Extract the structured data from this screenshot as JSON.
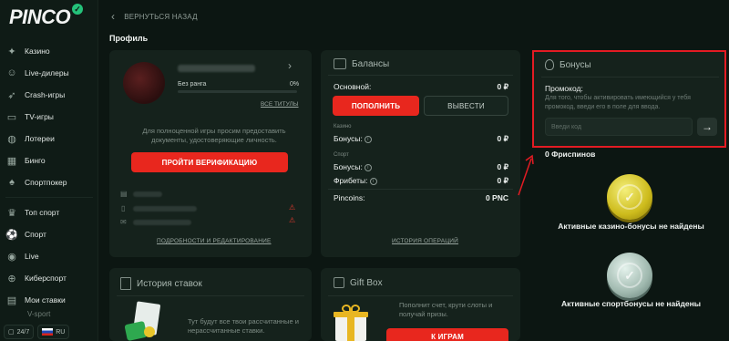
{
  "brand": {
    "logo": "PINCO",
    "logo_mark": "✓"
  },
  "sidebar": {
    "items": [
      {
        "label": "Казино",
        "icon": "casino-icon"
      },
      {
        "label": "Live-дилеры",
        "icon": "dealer-icon"
      },
      {
        "label": "Crash-игры",
        "icon": "rocket-icon"
      },
      {
        "label": "TV-игры",
        "icon": "tv-icon"
      },
      {
        "label": "Лотереи",
        "icon": "lottery-icon"
      },
      {
        "label": "Бинго",
        "icon": "bingo-icon"
      },
      {
        "label": "Спортпокер",
        "icon": "cards-icon"
      },
      {
        "label": "Топ спорт",
        "icon": "top-sport-icon"
      },
      {
        "label": "Спорт",
        "icon": "ball-icon"
      },
      {
        "label": "Live",
        "icon": "live-icon"
      },
      {
        "label": "Киберспорт",
        "icon": "gamepad-icon"
      },
      {
        "label": "Мои ставки",
        "icon": "bets-icon"
      }
    ],
    "v_sport": "V-sport",
    "support_label": "24/7",
    "language": "RU"
  },
  "header": {
    "back_label": "ВЕРНУТЬСЯ НАЗАД",
    "page_title": "Профиль"
  },
  "profile": {
    "rank_label": "Без ранга",
    "rank_progress_text": "0%",
    "rank_progress": 0,
    "all_titles": "ВСЕ ТИТУЛЫ",
    "verify_text": "Для полноценной игры просим предоставить документы, удостоверяющие личность.",
    "verify_button": "ПРОЙТИ ВЕРИФИКАЦИЮ",
    "details_link": "ПОДРОБНОСТИ И РЕДАКТИРОВАНИЕ"
  },
  "balances": {
    "title": "Балансы",
    "main_label": "Основной:",
    "main_value": "0 ₽",
    "deposit_button": "ПОПОЛНИТЬ",
    "withdraw_button": "ВЫВЕСТИ",
    "casino_section": "Казино",
    "casino_bonus_label": "Бонусы:",
    "casino_bonus_value": "0 ₽",
    "sport_section": "Спорт",
    "sport_bonus_label": "Бонусы:",
    "sport_bonus_value": "0 ₽",
    "freebets_label": "Фрибеты:",
    "freebets_value": "0 ₽",
    "pincoins_label": "Pincoins:",
    "pincoins_value": "0 PNC",
    "history_link": "ИСТОРИЯ ОПЕРАЦИЙ"
  },
  "bonuses": {
    "title": "Бонусы",
    "promo_label": "Промокод:",
    "promo_desc": "Для того, чтобы активировать имеющийся у тебя промокод, введи его в поле для ввода.",
    "promo_placeholder": "Введи код",
    "freespins": "0  Фриспинов",
    "casino_none": "Активные казино-бонусы не найдены",
    "sport_none": "Активные спортбонусы не найдены"
  },
  "bet_history": {
    "title": "История ставок",
    "desc": "Тут будут все твои рассчитанные и нерассчитанные ставки."
  },
  "gift_box": {
    "title": "Gift Box",
    "desc": "Пополнит счет, крути слоты и получай призы.",
    "button": "К ИГРАМ"
  },
  "colors": {
    "accent_red": "#e8271e",
    "highlight_border": "#e31b23",
    "background": "#0c1612",
    "card": "#15221c"
  }
}
